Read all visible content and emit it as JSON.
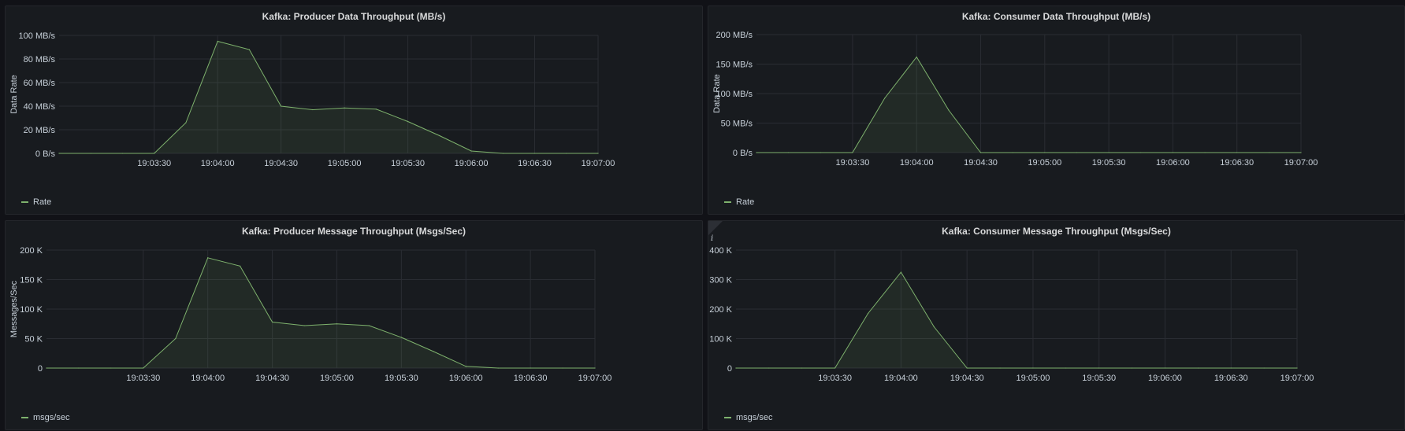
{
  "colors": {
    "series": "#7eb26d",
    "grid": "#2a2d33",
    "text": "#c7d0d9"
  },
  "chart_data": [
    {
      "type": "area",
      "title": "Kafka: Producer Data Throughput (MB/s)",
      "xlabel": "",
      "ylabel": "Data Rate",
      "x": [
        "19:02:45",
        "19:03:00",
        "19:03:15",
        "19:03:30",
        "19:03:45",
        "19:04:00",
        "19:04:15",
        "19:04:30",
        "19:04:45",
        "19:05:00",
        "19:05:15",
        "19:05:30",
        "19:05:45",
        "19:06:00",
        "19:06:15",
        "19:06:30",
        "19:06:45",
        "19:07:00"
      ],
      "xticks": [
        "19:03:30",
        "19:04:00",
        "19:04:30",
        "19:05:00",
        "19:05:30",
        "19:06:00",
        "19:06:30",
        "19:07:00"
      ],
      "ylim": [
        0,
        100
      ],
      "yticks": [
        0,
        20,
        40,
        60,
        80,
        100
      ],
      "ytick_labels": [
        "0 B/s",
        "20 MB/s",
        "40 MB/s",
        "60 MB/s",
        "80 MB/s",
        "100 MB/s"
      ],
      "grid": true,
      "legend": "bottom-left",
      "series": [
        {
          "name": "Rate",
          "values": [
            0,
            0,
            0,
            0,
            26,
            95,
            88,
            40,
            37,
            38.5,
            37.5,
            27,
            15,
            2,
            0,
            0,
            0,
            0
          ]
        }
      ]
    },
    {
      "type": "area",
      "title": "Kafka: Consumer Data Throughput (MB/s)",
      "xlabel": "",
      "ylabel": "Data Rate",
      "x": [
        "19:02:45",
        "19:03:00",
        "19:03:15",
        "19:03:30",
        "19:03:45",
        "19:04:00",
        "19:04:15",
        "19:04:30",
        "19:04:45",
        "19:05:00",
        "19:05:15",
        "19:05:30",
        "19:05:45",
        "19:06:00",
        "19:06:15",
        "19:06:30",
        "19:06:45",
        "19:07:00"
      ],
      "xticks": [
        "19:03:30",
        "19:04:00",
        "19:04:30",
        "19:05:00",
        "19:05:30",
        "19:06:00",
        "19:06:30",
        "19:07:00"
      ],
      "ylim": [
        0,
        200
      ],
      "yticks": [
        0,
        50,
        100,
        150,
        200
      ],
      "ytick_labels": [
        "0 B/s",
        "50 MB/s",
        "100 MB/s",
        "150 MB/s",
        "200 MB/s"
      ],
      "grid": true,
      "legend": "bottom-left",
      "series": [
        {
          "name": "Rate",
          "values": [
            0,
            0,
            0,
            0,
            92,
            162,
            72,
            0,
            0,
            0,
            0,
            0,
            0,
            0,
            0,
            0,
            0,
            0
          ]
        }
      ]
    },
    {
      "type": "area",
      "title": "Kafka: Producer Message Throughput (Msgs/Sec)",
      "xlabel": "",
      "ylabel": "Messages/Sec",
      "x": [
        "19:02:45",
        "19:03:00",
        "19:03:15",
        "19:03:30",
        "19:03:45",
        "19:04:00",
        "19:04:15",
        "19:04:30",
        "19:04:45",
        "19:05:00",
        "19:05:15",
        "19:05:30",
        "19:05:45",
        "19:06:00",
        "19:06:15",
        "19:06:30",
        "19:06:45",
        "19:07:00"
      ],
      "xticks": [
        "19:03:30",
        "19:04:00",
        "19:04:30",
        "19:05:00",
        "19:05:30",
        "19:06:00",
        "19:06:30",
        "19:07:00"
      ],
      "ylim": [
        0,
        200000
      ],
      "yticks": [
        0,
        50000,
        100000,
        150000,
        200000
      ],
      "ytick_labels": [
        "0",
        "50 K",
        "100 K",
        "150 K",
        "200 K"
      ],
      "grid": true,
      "legend": "bottom-left",
      "series": [
        {
          "name": "msgs/sec",
          "values": [
            0,
            0,
            0,
            0,
            50000,
            187000,
            173000,
            78000,
            72000,
            75000,
            72000,
            52000,
            28000,
            3000,
            0,
            0,
            0,
            0
          ]
        }
      ]
    },
    {
      "type": "area",
      "title": "Kafka: Consumer Message Throughput (Msgs/Sec)",
      "xlabel": "",
      "ylabel": "",
      "x": [
        "19:02:45",
        "19:03:00",
        "19:03:15",
        "19:03:30",
        "19:03:45",
        "19:04:00",
        "19:04:15",
        "19:04:30",
        "19:04:45",
        "19:05:00",
        "19:05:15",
        "19:05:30",
        "19:05:45",
        "19:06:00",
        "19:06:15",
        "19:06:30",
        "19:06:45",
        "19:07:00"
      ],
      "xticks": [
        "19:03:30",
        "19:04:00",
        "19:04:30",
        "19:05:00",
        "19:05:30",
        "19:06:00",
        "19:06:30",
        "19:07:00"
      ],
      "ylim": [
        0,
        400000
      ],
      "yticks": [
        0,
        100000,
        200000,
        300000,
        400000
      ],
      "ytick_labels": [
        "0",
        "100 K",
        "200 K",
        "300 K",
        "400 K"
      ],
      "grid": true,
      "legend": "bottom-left",
      "series": [
        {
          "name": "msgs/sec",
          "values": [
            0,
            0,
            0,
            0,
            185000,
            325000,
            140000,
            0,
            0,
            0,
            0,
            0,
            0,
            0,
            0,
            0,
            0,
            0
          ]
        }
      ]
    }
  ]
}
